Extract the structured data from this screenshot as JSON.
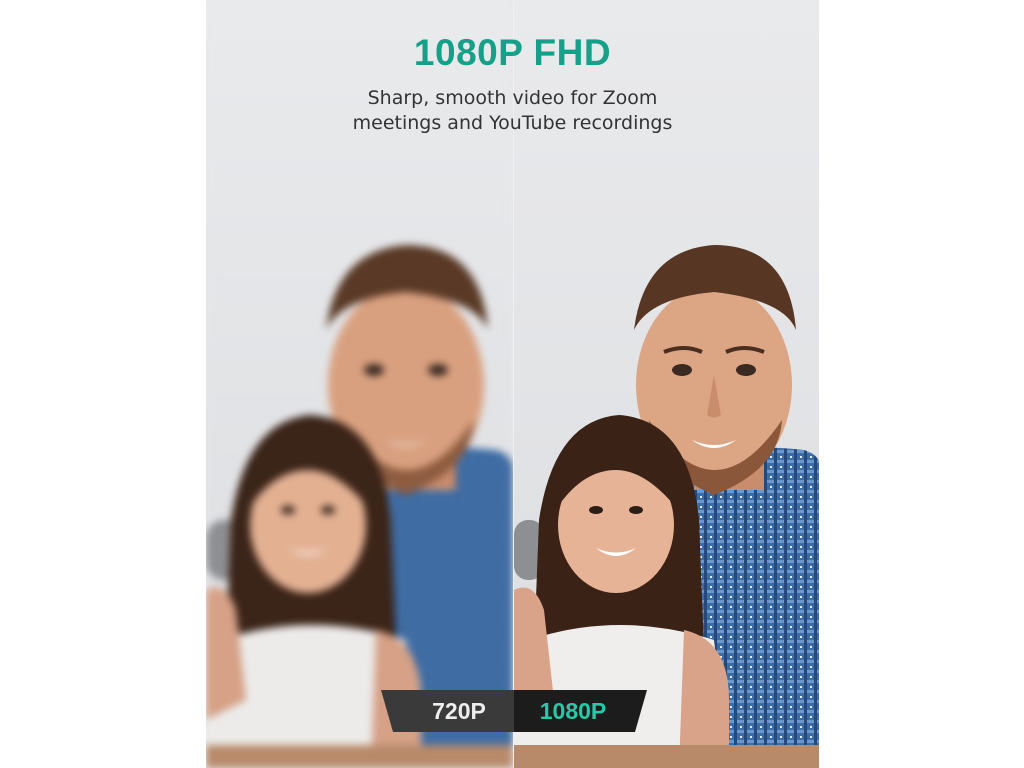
{
  "headline": "1080P FHD",
  "subline": {
    "line1": "Sharp, smooth video for Zoom",
    "line2": "meetings and YouTube recordings"
  },
  "badges": {
    "low": "720P",
    "high": "1080P"
  },
  "colors": {
    "accent": "#16a08a",
    "badge_high_text": "#27c9a8",
    "background": "#e7e8ea",
    "shirt": "#3f6fa8"
  }
}
